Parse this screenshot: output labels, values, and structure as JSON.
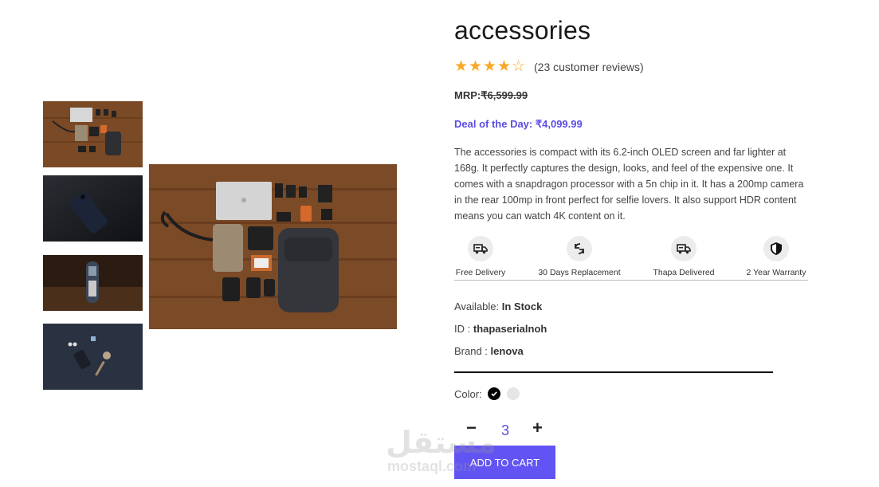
{
  "product": {
    "title": "accessories",
    "rating": 4,
    "rating_max": 5,
    "reviews_text": "(23 customer reviews)",
    "mrp_label": "MRP:",
    "mrp_price": "₹6,599.99",
    "deal_text": "Deal of the Day: ₹4,099.99",
    "description": "The accessories is compact with its 6.2-inch OLED screen and far lighter at 168g. It perfectly captures the design, looks, and feel of the expensive one. It comes with a snapdragon processor with a 5n chip in it. It has a 200mp camera in the rear 100mp in front perfect for selfie lovers. It also support HDR content means you can watch 4K content on it."
  },
  "features": [
    {
      "icon": "truck-icon",
      "label": "Free Delivery"
    },
    {
      "icon": "replace-icon",
      "label": "30 Days Replacement"
    },
    {
      "icon": "truck-icon",
      "label": "Thapa Delivered"
    },
    {
      "icon": "shield-icon",
      "label": "2 Year Warranty"
    }
  ],
  "info": {
    "available_label": "Available:",
    "available_value": "In Stock",
    "id_label": "ID :",
    "id_value": "thapaserialnoh",
    "brand_label": "Brand :",
    "brand_value": "lenova"
  },
  "color": {
    "label": "Color:",
    "options": [
      "#000000",
      "#e6e6e6"
    ],
    "selected": "#000000"
  },
  "quantity": {
    "minus": "−",
    "value": "3",
    "plus": "+"
  },
  "cart_button": "ADD TO CART",
  "watermark": {
    "arabic": "مستقل",
    "latin": "mostaql.com"
  },
  "colors": {
    "accent": "#6254f3",
    "star": "#f9a825",
    "deal": "#5a4ee3"
  }
}
